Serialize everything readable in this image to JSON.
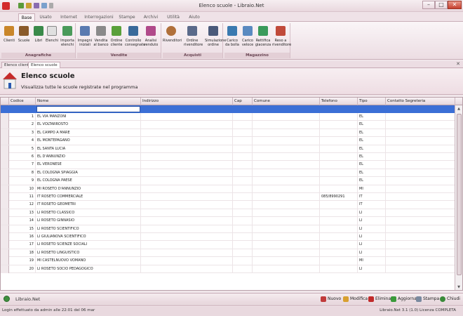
{
  "window": {
    "title": "Elenco scuole - Libraio.Net"
  },
  "ribbon_tabs": [
    "Base",
    "Usato",
    "Internet",
    "Interrogazioni",
    "Stampe",
    "Archivi",
    "Utilità",
    "Aiuto"
  ],
  "groups": {
    "anagrafiche": {
      "label": "Anagrafiche",
      "buttons": [
        "Clienti",
        "Scuole",
        "Libri",
        "Elenchi",
        "Importa\nelenchi"
      ]
    },
    "vendite": {
      "label": "Vendite",
      "buttons": [
        "Impegni\niniziali",
        "Vendita\nal banco",
        "Ordine\ncliente",
        "Controllo\nconsegnato",
        "Analisi\nvenduto"
      ]
    },
    "acquisti": {
      "label": "Acquisti",
      "buttons": [
        "Rivenditori",
        "Ordine\nrivenditore",
        "Simulazione\nordine"
      ]
    },
    "magazzino": {
      "label": "Magazzino",
      "buttons": [
        "Carico\nda bolla",
        "Carico\nveloce",
        "Rettifica\ngiacenza",
        "Reso a\nrivenditore"
      ]
    }
  },
  "doc_tabs": [
    "Elenco clienti",
    "Elenco scuole"
  ],
  "page": {
    "title": "Elenco scuole",
    "subtitle": "Visualizza tutte le scuole registrate nel programma"
  },
  "table": {
    "columns": [
      "Codice",
      "Nome",
      "Indirizzo",
      "Cap",
      "Comune",
      "Telefono",
      "Tipo",
      "Contatto Segreteria"
    ],
    "rows": [
      {
        "codice": "1",
        "nome": "EL VIA MANZONI",
        "telefono": "",
        "tipo": "EL"
      },
      {
        "codice": "2",
        "nome": "EL VOLTARROSTO",
        "telefono": "",
        "tipo": "EL"
      },
      {
        "codice": "3",
        "nome": "EL CAMPO A MARE",
        "telefono": "",
        "tipo": "EL"
      },
      {
        "codice": "4",
        "nome": "EL MONTEPAGANO",
        "telefono": "",
        "tipo": "EL"
      },
      {
        "codice": "5",
        "nome": "EL SANTA LUCIA",
        "telefono": "",
        "tipo": "EL"
      },
      {
        "codice": "6",
        "nome": "EL D'ANNUNZIO",
        "telefono": "",
        "tipo": "EL"
      },
      {
        "codice": "7",
        "nome": "EL VERONESE",
        "telefono": "",
        "tipo": "EL"
      },
      {
        "codice": "8",
        "nome": "EL COLOGNA SPIAGGIA",
        "telefono": "",
        "tipo": "EL"
      },
      {
        "codice": "9",
        "nome": "EL COLOGNA PAESE",
        "telefono": "",
        "tipo": "EL"
      },
      {
        "codice": "10",
        "nome": "MI ROSETO D'ANNUNZIO",
        "telefono": "",
        "tipo": "MI"
      },
      {
        "codice": "11",
        "nome": "IT ROSETO COMMERCIALE",
        "telefono": "085/8990291",
        "tipo": "IT"
      },
      {
        "codice": "12",
        "nome": "IT ROSETO GEOMETRI",
        "telefono": "",
        "tipo": "IT"
      },
      {
        "codice": "13",
        "nome": "LI ROSETO CLASSICO",
        "telefono": "",
        "tipo": "LI"
      },
      {
        "codice": "14",
        "nome": "LI ROSETO  GINNASIO",
        "telefono": "",
        "tipo": "LI"
      },
      {
        "codice": "15",
        "nome": "LI ROSETO SCIENTIFICO",
        "telefono": "",
        "tipo": "LI"
      },
      {
        "codice": "16",
        "nome": "LI GIULIANOVA SCIENTIFICO",
        "telefono": "",
        "tipo": "LI"
      },
      {
        "codice": "17",
        "nome": "LI ROSETO SCIENZE SOCIALI",
        "telefono": "",
        "tipo": "LI"
      },
      {
        "codice": "18",
        "nome": "LI ROSETO LINGUISTICO",
        "telefono": "",
        "tipo": "LI"
      },
      {
        "codice": "19",
        "nome": "MI CASTELNUOVO VOMANO",
        "telefono": "",
        "tipo": "MI"
      },
      {
        "codice": "20",
        "nome": "LI ROSETO SOCIO PEDAGOGICO",
        "telefono": "",
        "tipo": "LI"
      }
    ]
  },
  "footer": {
    "brand": "Libraio.Net",
    "buttons": [
      "Nuovo",
      "Modifica",
      "Elimina",
      "Aggiorna",
      "Stampa",
      "Chiudi"
    ]
  },
  "status": {
    "left": "Login effettuato da admin alle 22:01 del 06 mar",
    "right": "Libraio.Net 3.1 (1.0) Licenza COMPLETA"
  },
  "colors": {
    "accent": "#3b6fd6",
    "chrome": "#f0e6ea",
    "brand_red": "#d32a2a"
  }
}
